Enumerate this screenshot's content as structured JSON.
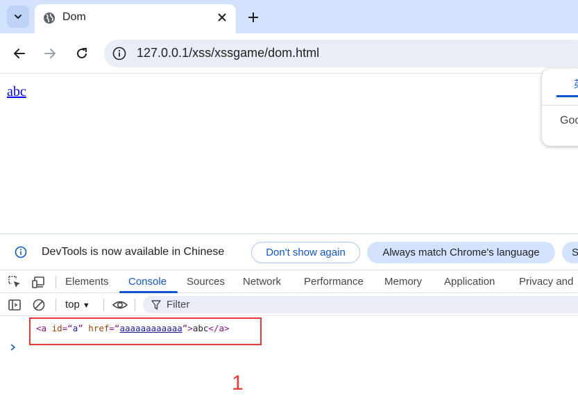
{
  "browser": {
    "tab": {
      "title": "Dom"
    },
    "address": {
      "url": "127.0.0.1/xss/xssgame/dom.html"
    }
  },
  "page": {
    "link_text": "abc",
    "popup": {
      "tab_glyph": "英",
      "text": "Goo"
    }
  },
  "devtools": {
    "infobar": {
      "message": "DevTools is now available in Chinese",
      "dont_show": "Don't show again",
      "always_match": "Always match Chrome's language",
      "cut_button": "S"
    },
    "panels": [
      "Elements",
      "Console",
      "Sources",
      "Network",
      "Performance",
      "Memory",
      "Application",
      "Privacy and"
    ],
    "active_panel": "Console",
    "console_toolbar": {
      "context": "top",
      "filter_placeholder": "Filter"
    },
    "log": {
      "open_tag": "<a ",
      "attr1_name": "id",
      "attr1_eq": "=“",
      "attr1_value": "a",
      "attr1_close": "” ",
      "attr2_name": "href",
      "attr2_eq": "=“",
      "attr2_value": "aaaaaaaaaaaa",
      "attr2_close": "”",
      "tag_end": ">",
      "text": "abc",
      "close_tag": "</a>"
    },
    "annotation": "1"
  },
  "colors": {
    "accent": "#0b57d0",
    "highlight": "#e53935",
    "tabstrip": "#d3e3fd"
  }
}
